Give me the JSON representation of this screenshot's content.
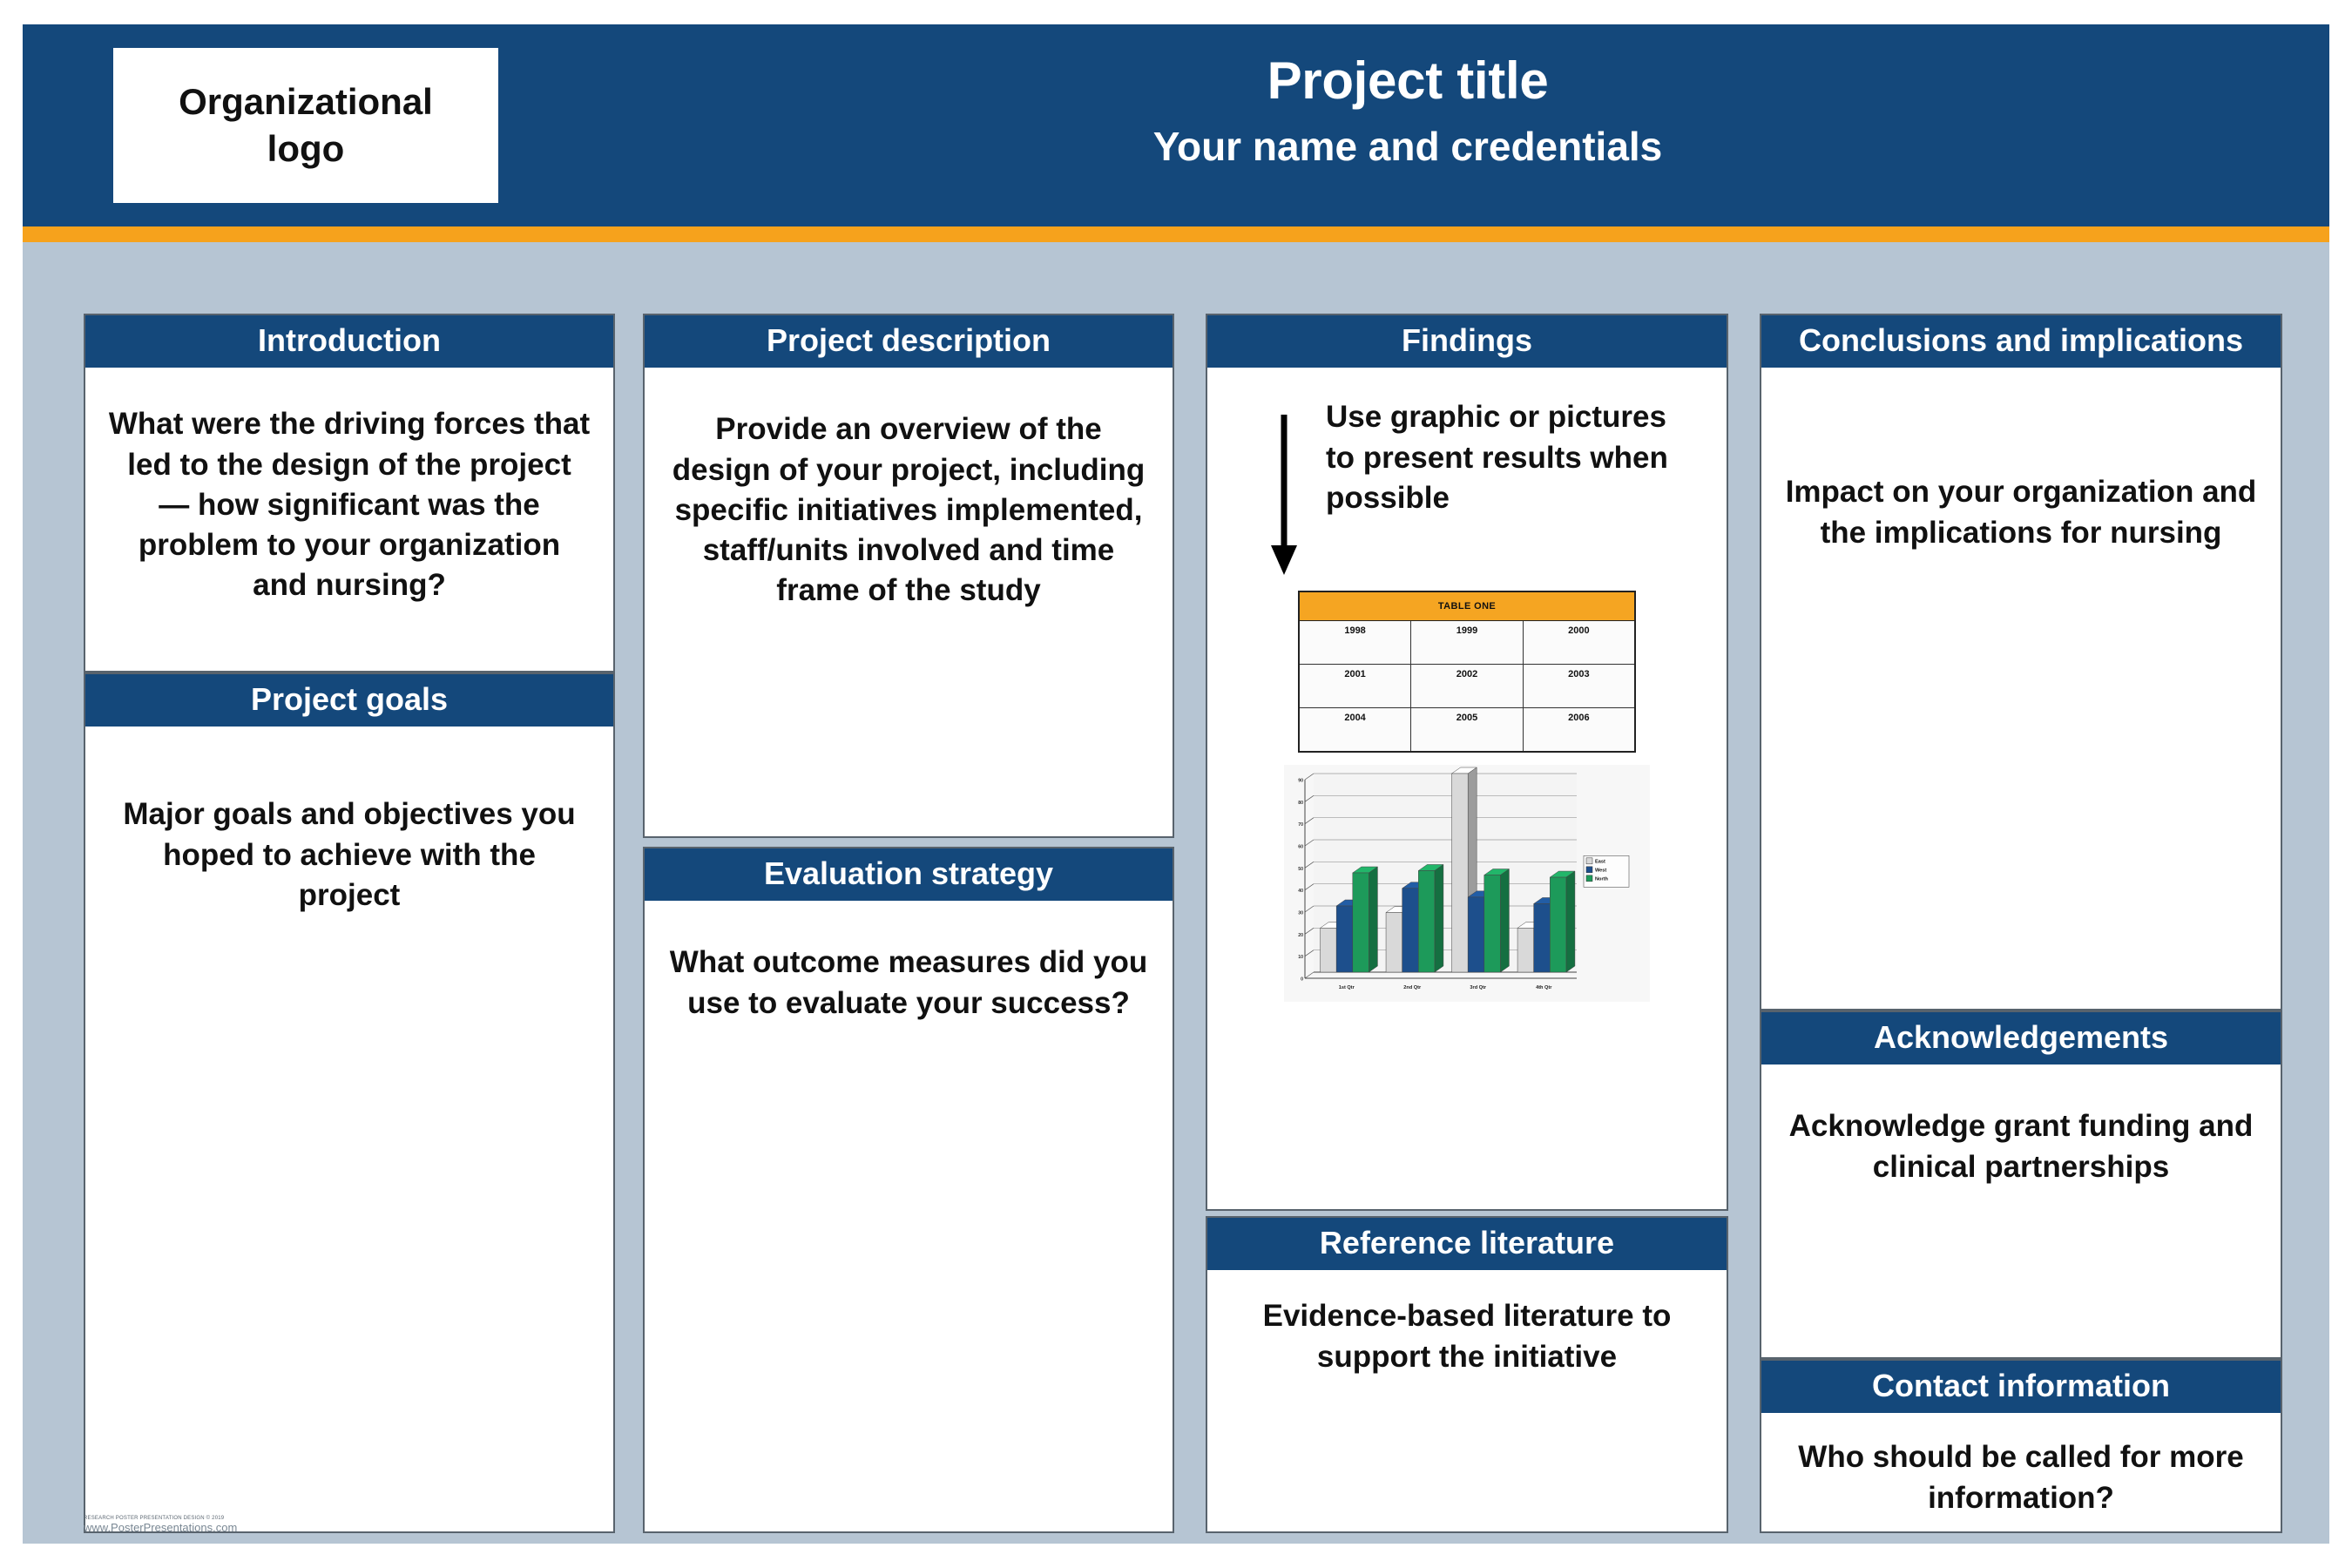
{
  "theme": {
    "header_blue": "#14487b",
    "accent_orange": "#f6a21c",
    "body_bluegray": "#b6c5d3",
    "panel_white": "#ffffff",
    "panel_border": "#58636d",
    "text_black": "#111111"
  },
  "header": {
    "logo_line1": "Organizational",
    "logo_line2": "logo",
    "title": "Project title",
    "authors": "Your name and credentials"
  },
  "columns": {
    "col1": {
      "introduction": {
        "heading": "Introduction",
        "body": "What were the driving forces that led to the design of the project — how significant was the problem to your organization and nursing?"
      },
      "project_goals": {
        "heading": "Project goals",
        "body": "Major goals and objectives you hoped to achieve with the project"
      }
    },
    "col2": {
      "project_description": {
        "heading": "Project description",
        "body": "Provide an overview of the design of your project, including specific initiatives implemented, staff/units involved and time frame of the study"
      },
      "evaluation_strategy": {
        "heading": "Evaluation strategy",
        "body": "What outcome measures did you use to evaluate your success?"
      }
    },
    "col3": {
      "findings": {
        "heading": "Findings",
        "caption": "Use graphic or pictures to present results when possible",
        "arrow_icon": "down-arrow-icon"
      },
      "reference_literature": {
        "heading": "Reference literature",
        "body": "Evidence-based literature to support the initiative"
      }
    },
    "col4": {
      "conclusions": {
        "heading": "Conclusions and implications",
        "body": "Impact on your organization and the implications for nursing"
      },
      "acknowledgements": {
        "heading": "Acknowledgements",
        "body": "Acknowledge grant funding and clinical partnerships"
      },
      "contact_information": {
        "heading": "Contact information",
        "body": "Who should be called for more information?"
      }
    }
  },
  "table_graphic": {
    "title": "TABLE ONE",
    "rows": [
      [
        "1998",
        "1999",
        "2000"
      ],
      [
        "2001",
        "2002",
        "2003"
      ],
      [
        "2004",
        "2005",
        "2006"
      ]
    ]
  },
  "chart_data": {
    "type": "bar",
    "title": "",
    "xlabel": "",
    "ylabel": "",
    "categories": [
      "1st Qtr",
      "2nd Qtr",
      "3rd Qtr",
      "4th Qtr"
    ],
    "series": [
      {
        "name": "East",
        "color": "#d9d9d9",
        "values": [
          20,
          27,
          90,
          20
        ]
      },
      {
        "name": "West",
        "color": "#1d4f8c",
        "values": [
          30,
          38,
          34,
          31
        ]
      },
      {
        "name": "North",
        "color": "#1d9a5a",
        "values": [
          45,
          46,
          44,
          43
        ]
      }
    ],
    "ylim": [
      0,
      90
    ],
    "yticks": [
      0,
      10,
      20,
      30,
      40,
      50,
      60,
      70,
      80,
      90
    ],
    "grid": true,
    "legend_position": "right"
  },
  "footer": {
    "credit_small": "RESEARCH POSTER PRESENTATION DESIGN © 2019",
    "credit_url": "www.PosterPresentations.com"
  }
}
